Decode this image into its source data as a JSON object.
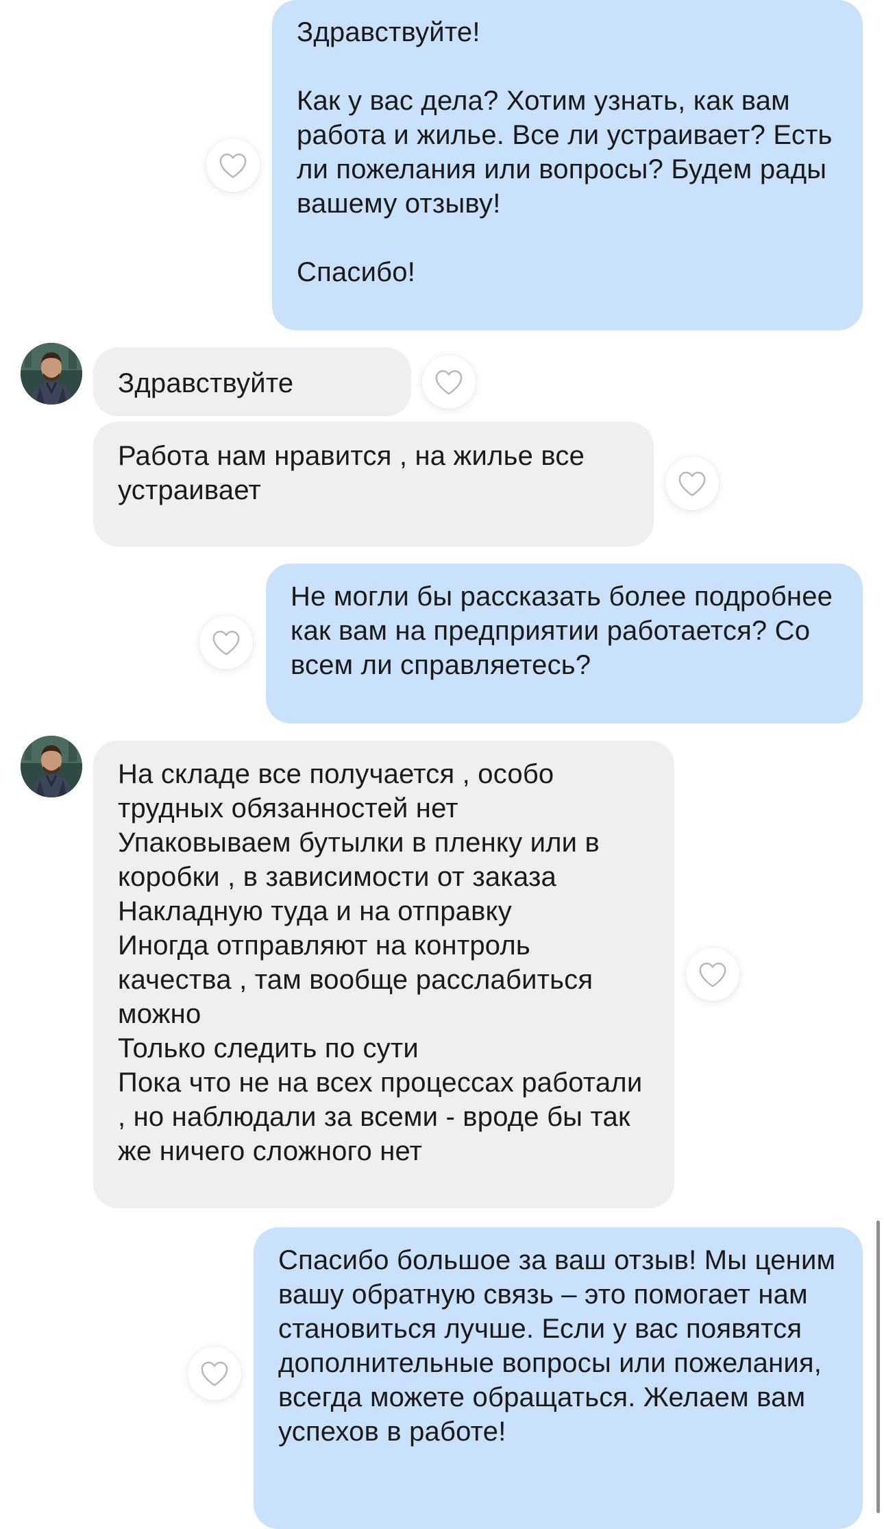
{
  "colors": {
    "outgoing_bubble": "#c9e1fb",
    "incoming_bubble": "#efefef",
    "text": "#1a1a1a",
    "heart_outline": "#b9b9b9"
  },
  "icons": {
    "heart": "heart-outline-icon",
    "avatar": "user-avatar"
  },
  "messages": [
    {
      "direction": "outgoing",
      "text": "Здравствуйте!\n\nКак у вас дела? Хотим узнать, как вам работа и жилье. Все ли устраивает? Есть ли пожелания или вопросы? Будем рады вашему отзыву!\n\nСпасибо!"
    },
    {
      "direction": "incoming",
      "text": "Здравствуйте"
    },
    {
      "direction": "incoming",
      "text": "Работа нам нравится , на жилье все устраивает"
    },
    {
      "direction": "outgoing",
      "text": "Не могли бы рассказать более подробнее как вам на предприятии работается? Со всем ли справляетесь?"
    },
    {
      "direction": "incoming",
      "text": "На складе все получается , особо трудных обязанностей нет\nУпаковываем бутылки в пленку или в коробки , в зависимости от заказа\nНакладную туда и на отправку\nИногда отправляют на контроль качества , там вообще расслабиться можно\nТолько следить по сути\nПока что не на всех процессах работали , но наблюдали за всеми - вроде бы так же ничего сложного нет"
    },
    {
      "direction": "outgoing",
      "text": "Спасибо большое за ваш отзыв! Мы ценим вашу обратную связь – это помогает нам становиться лучше. Если у вас появятся дополнительные вопросы или пожелания, всегда можете обращаться. Желаем вам успехов в работе!"
    }
  ]
}
